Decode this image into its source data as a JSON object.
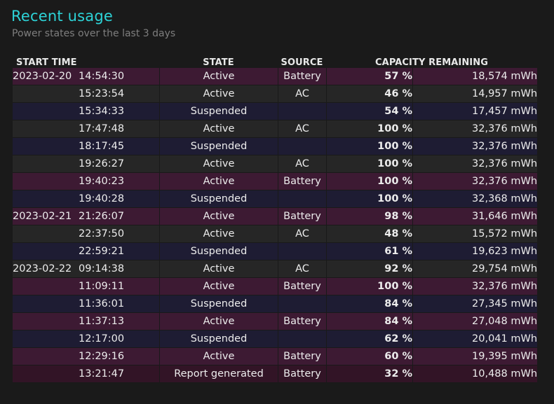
{
  "page": {
    "title": "Recent usage",
    "subtitle": "Power states over the last 3 days"
  },
  "table": {
    "headers": {
      "start_time": "START TIME",
      "state": "STATE",
      "source": "SOURCE",
      "capacity": "CAPACITY REMAINING"
    },
    "rows": [
      {
        "date": "2023-02-20",
        "time": "14:54:30",
        "state": "Active",
        "source": "Battery",
        "percent": "57 %",
        "energy": "18,574 mWh"
      },
      {
        "date": "",
        "time": "15:23:54",
        "state": "Active",
        "source": "AC",
        "percent": "46 %",
        "energy": "14,957 mWh"
      },
      {
        "date": "",
        "time": "15:34:33",
        "state": "Suspended",
        "source": "",
        "percent": "54 %",
        "energy": "17,457 mWh"
      },
      {
        "date": "",
        "time": "17:47:48",
        "state": "Active",
        "source": "AC",
        "percent": "100 %",
        "energy": "32,376 mWh"
      },
      {
        "date": "",
        "time": "18:17:45",
        "state": "Suspended",
        "source": "",
        "percent": "100 %",
        "energy": "32,376 mWh"
      },
      {
        "date": "",
        "time": "19:26:27",
        "state": "Active",
        "source": "AC",
        "percent": "100 %",
        "energy": "32,376 mWh"
      },
      {
        "date": "",
        "time": "19:40:23",
        "state": "Active",
        "source": "Battery",
        "percent": "100 %",
        "energy": "32,376 mWh"
      },
      {
        "date": "",
        "time": "19:40:28",
        "state": "Suspended",
        "source": "",
        "percent": "100 %",
        "energy": "32,368 mWh"
      },
      {
        "date": "2023-02-21",
        "time": "21:26:07",
        "state": "Active",
        "source": "Battery",
        "percent": "98 %",
        "energy": "31,646 mWh"
      },
      {
        "date": "",
        "time": "22:37:50",
        "state": "Active",
        "source": "AC",
        "percent": "48 %",
        "energy": "15,572 mWh"
      },
      {
        "date": "",
        "time": "22:59:21",
        "state": "Suspended",
        "source": "",
        "percent": "61 %",
        "energy": "19,623 mWh"
      },
      {
        "date": "2023-02-22",
        "time": "09:14:38",
        "state": "Active",
        "source": "AC",
        "percent": "92 %",
        "energy": "29,754 mWh"
      },
      {
        "date": "",
        "time": "11:09:11",
        "state": "Active",
        "source": "Battery",
        "percent": "100 %",
        "energy": "32,376 mWh"
      },
      {
        "date": "",
        "time": "11:36:01",
        "state": "Suspended",
        "source": "",
        "percent": "84 %",
        "energy": "27,345 mWh"
      },
      {
        "date": "",
        "time": "11:37:13",
        "state": "Active",
        "source": "Battery",
        "percent": "84 %",
        "energy": "27,048 mWh"
      },
      {
        "date": "",
        "time": "12:17:00",
        "state": "Suspended",
        "source": "",
        "percent": "62 %",
        "energy": "20,041 mWh"
      },
      {
        "date": "",
        "time": "12:29:16",
        "state": "Active",
        "source": "Battery",
        "percent": "60 %",
        "energy": "19,395 mWh"
      },
      {
        "date": "",
        "time": "13:21:47",
        "state": "Report generated",
        "source": "Battery",
        "percent": "32 %",
        "energy": "10,488 mWh"
      }
    ]
  },
  "colors": {
    "title": "#2dd3d7",
    "battery_row": "#3d1a33",
    "ac_row": "#262626",
    "suspended_row": "#1e1c33",
    "report_row": "#321426"
  }
}
